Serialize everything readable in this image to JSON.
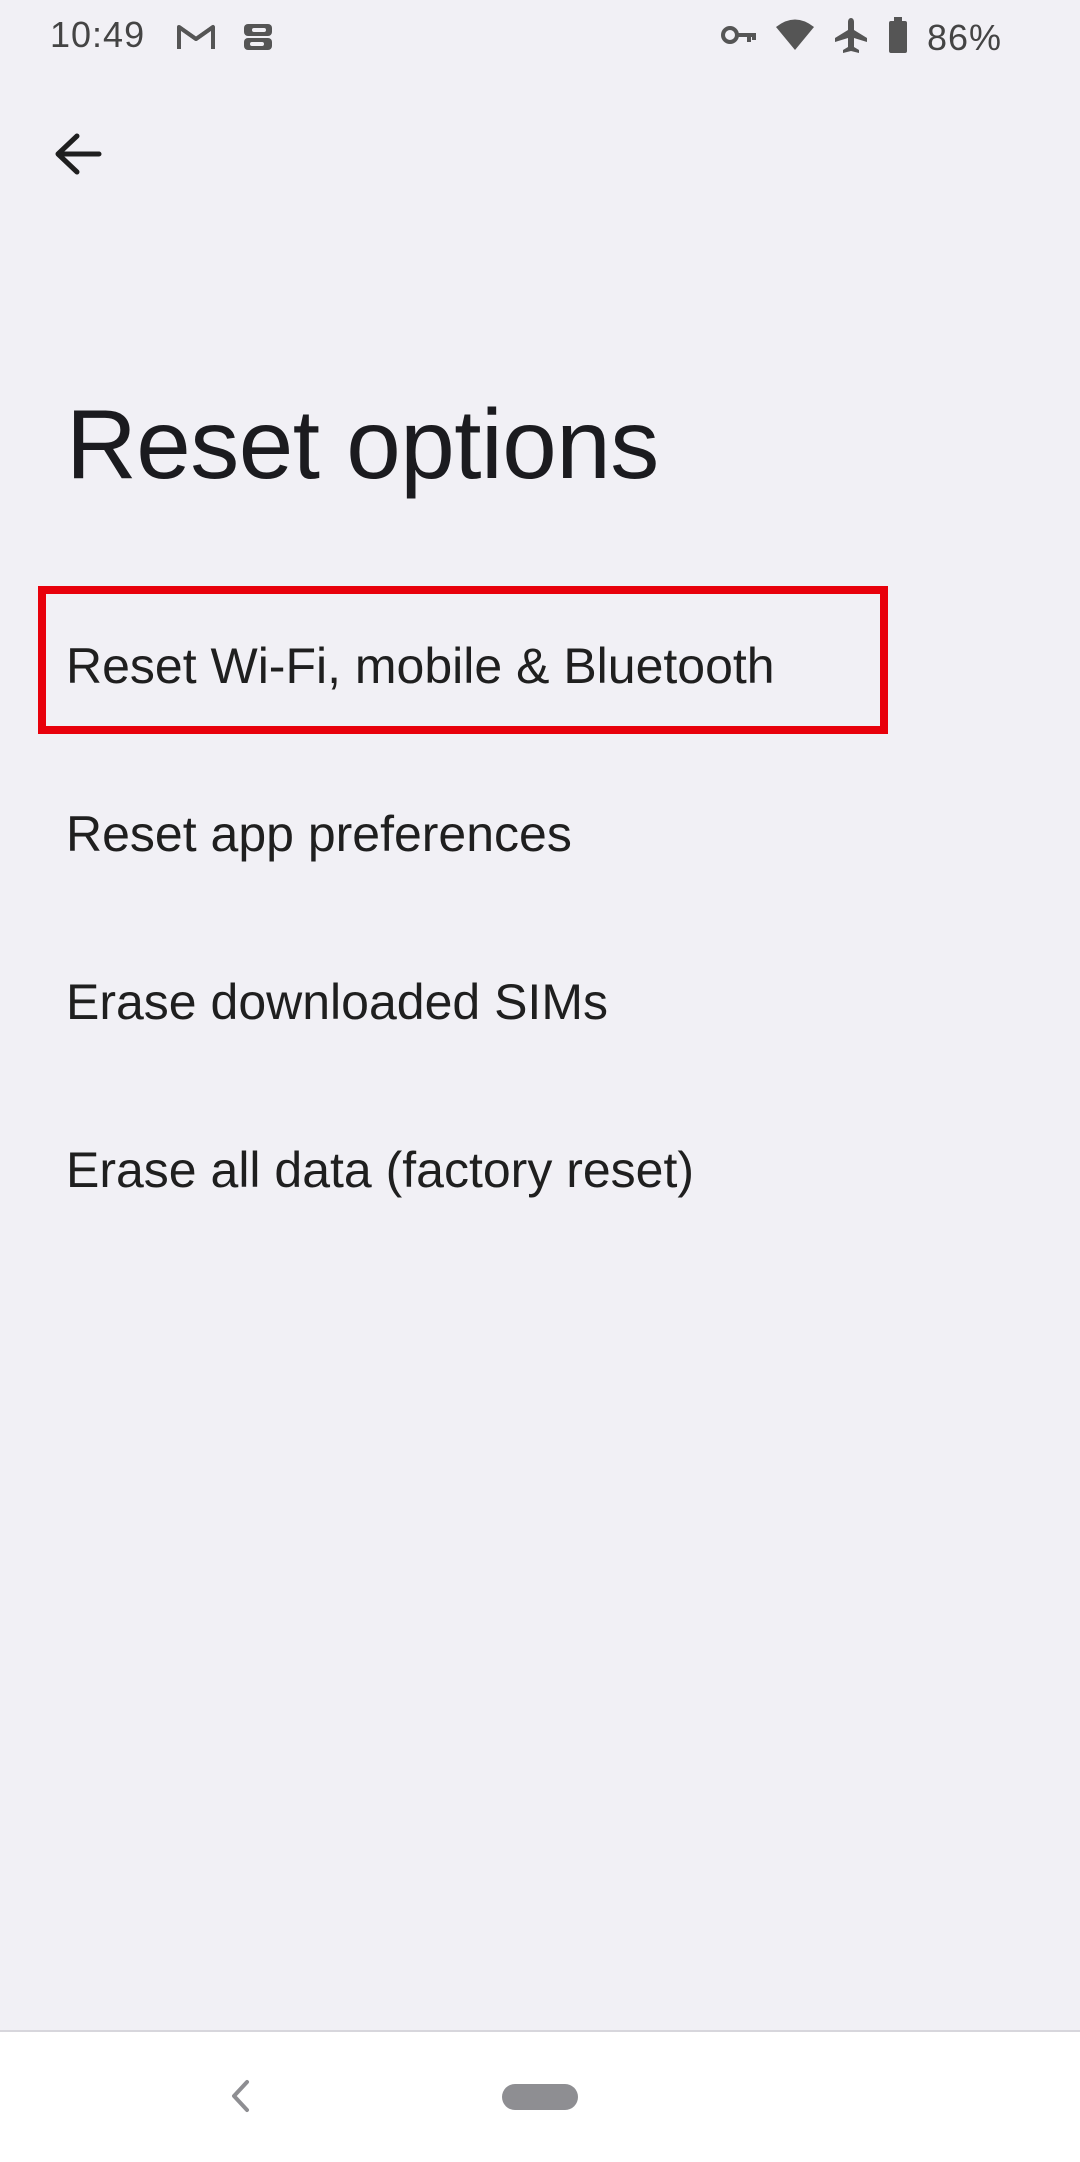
{
  "status_bar": {
    "time": "10:49",
    "battery_percent": "86%",
    "left_icons": [
      "gmail-icon",
      "sync-icon"
    ],
    "right_icons": [
      "vpn-key-icon",
      "wifi-icon",
      "airplane-icon",
      "battery-icon"
    ]
  },
  "header": {
    "back_icon": "arrow-back-icon",
    "title": "Reset options"
  },
  "options": [
    {
      "label": "Reset Wi-Fi, mobile & Bluetooth",
      "highlighted": true
    },
    {
      "label": "Reset app preferences"
    },
    {
      "label": "Erase downloaded SIMs"
    },
    {
      "label": "Erase all data (factory reset)"
    }
  ],
  "highlight_color": "#e8000b",
  "nav_bar": {
    "back_icon": "nav-back-chevron-icon",
    "home_icon": "home-pill-icon"
  }
}
